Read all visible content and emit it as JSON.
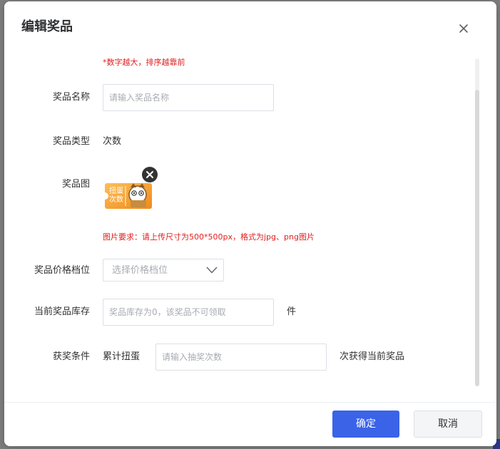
{
  "dialog": {
    "title": "编辑奖品",
    "close_icon": "close-icon"
  },
  "form": {
    "sort_hint": "*数字越大，排序越靠前",
    "prize_name": {
      "label": "奖品名称",
      "placeholder": "请输入奖品名称",
      "value": ""
    },
    "prize_type": {
      "label": "奖品类型",
      "value": "次数"
    },
    "prize_image": {
      "label": "奖品图",
      "thumbnail_text_line1": "扭蛋",
      "thumbnail_text_line2": "次数",
      "remove_icon": "remove-circle-icon",
      "requirement": "图片要求：请上传尺寸为500*500px，格式为jpg、png图片"
    },
    "price_tier": {
      "label": "奖品价格档位",
      "placeholder": "选择价格档位",
      "arrow_icon": "chevron-down-icon"
    },
    "stock": {
      "label": "当前奖品库存",
      "placeholder": "奖品库存为0，该奖品不可领取",
      "value": "",
      "unit": "件"
    },
    "win_condition": {
      "label": "获奖条件",
      "prefix": "累计扭蛋",
      "placeholder": "请输入抽奖次数",
      "value": "",
      "suffix": "次获得当前奖品"
    }
  },
  "footer": {
    "confirm_label": "确定",
    "cancel_label": "取消"
  },
  "colors": {
    "primary": "#3a63e8",
    "hint_red": "#e02020",
    "thumbnail_orange": "#f5a623",
    "backdrop": "#7f7f7f"
  }
}
